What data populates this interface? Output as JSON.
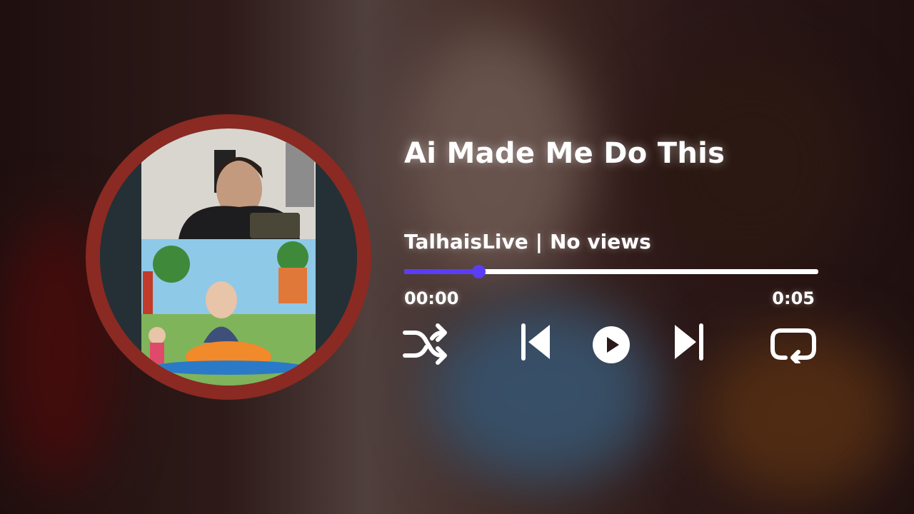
{
  "track": {
    "title": "Ai Made Me Do This",
    "channel": "TalhaisLive",
    "separator": "|",
    "views": "No views"
  },
  "playback": {
    "current_time": "00:00",
    "duration": "0:05",
    "progress_fraction": 0.18
  },
  "controls": {
    "shuffle_icon": "shuffle-icon",
    "previous_icon": "skip-previous-icon",
    "play_icon": "play-icon",
    "next_icon": "skip-next-icon",
    "repeat_icon": "repeat-icon"
  },
  "colors": {
    "accent": "#5b3df5",
    "cover_ring": "#8a2a22",
    "text": "#ffffff"
  }
}
